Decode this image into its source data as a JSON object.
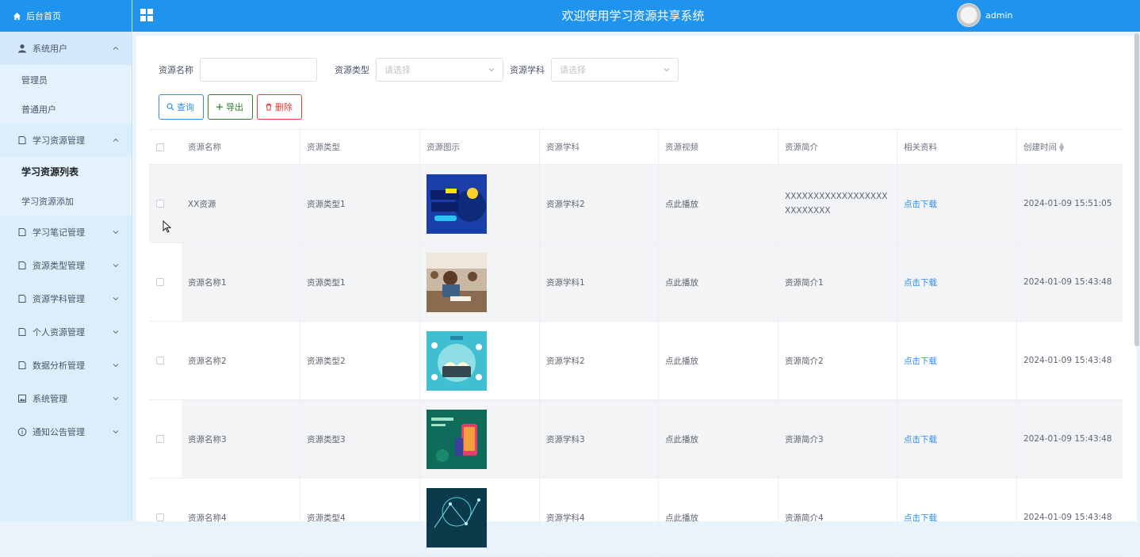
{
  "sidebar": {
    "home_label": "后台首页",
    "groups": [
      {
        "label": "系统用户",
        "icon": "user-icon",
        "expanded": true,
        "items": [
          {
            "label": "管理员"
          },
          {
            "label": "普通用户"
          }
        ]
      },
      {
        "label": "学习资源管理",
        "icon": "document-icon",
        "expanded": true,
        "items": [
          {
            "label": "学习资源列表",
            "active": true
          },
          {
            "label": "学习资源添加"
          }
        ]
      },
      {
        "label": "学习笔记管理",
        "icon": "document-icon"
      },
      {
        "label": "资源类型管理",
        "icon": "document-icon"
      },
      {
        "label": "资源学科管理",
        "icon": "document-icon"
      },
      {
        "label": "个人资源管理",
        "icon": "document-icon"
      },
      {
        "label": "数据分析管理",
        "icon": "document-icon"
      },
      {
        "label": "系统管理",
        "icon": "image-icon"
      },
      {
        "label": "通知公告管理",
        "icon": "info-icon"
      }
    ]
  },
  "header": {
    "title": "欢迎使用学习资源共享系统",
    "username": "admin"
  },
  "filters": {
    "name_label": "资源名称",
    "name_value": "",
    "type_label": "资源类型",
    "type_placeholder": "请选择",
    "subject_label": "资源学科",
    "subject_placeholder": "请选择"
  },
  "buttons": {
    "query": "查询",
    "export": "导出",
    "delete": "删除"
  },
  "table": {
    "columns": [
      "资源名称",
      "资源类型",
      "资源图示",
      "资源学科",
      "资源视频",
      "资源简介",
      "相关资料",
      "创建时间"
    ],
    "rows": [
      {
        "name": "XX资源",
        "type": "资源类型1",
        "image": "poster-math",
        "subject": "资源学科2",
        "video": "点此播放",
        "intro": "XXXXXXXXXXXXXXXXXXXXXXXXXX",
        "material": "点击下载",
        "created": "2024-01-09 15:51:05"
      },
      {
        "name": "资源名称1",
        "type": "资源类型1",
        "image": "photo-classroom",
        "subject": "资源学科1",
        "video": "点此播放",
        "intro": "资源简介1",
        "material": "点击下载",
        "created": "2024-01-09 15:43:48"
      },
      {
        "name": "资源名称2",
        "type": "资源类型2",
        "image": "illustration-laptop",
        "subject": "资源学科2",
        "video": "点此播放",
        "intro": "资源简介2",
        "material": "点击下载",
        "created": "2024-01-09 15:43:48"
      },
      {
        "name": "资源名称3",
        "type": "资源类型3",
        "image": "illustration-phone",
        "subject": "资源学科3",
        "video": "点此播放",
        "intro": "资源简介3",
        "material": "点击下载",
        "created": "2024-01-09 15:43:48"
      },
      {
        "name": "资源名称4",
        "type": "资源类型4",
        "image": "illustration-network",
        "subject": "资源学科4",
        "video": "点此播放",
        "intro": "资源简介4",
        "material": "点击下载",
        "created": "2024-01-09 15:43:48"
      }
    ]
  },
  "colors": {
    "header_bg": "#1e94ee",
    "sidebar_bg": "#dbeefb",
    "link": "#2d8cf0",
    "query_btn": "#2d8cf0",
    "export_btn": "#2e7d32",
    "delete_btn": "#e53935"
  },
  "icons": {
    "home": "home-icon",
    "grid": "grid-icon",
    "search": "search-icon",
    "plus": "plus-icon",
    "trash": "trash-icon",
    "sort": "sort-icon"
  }
}
